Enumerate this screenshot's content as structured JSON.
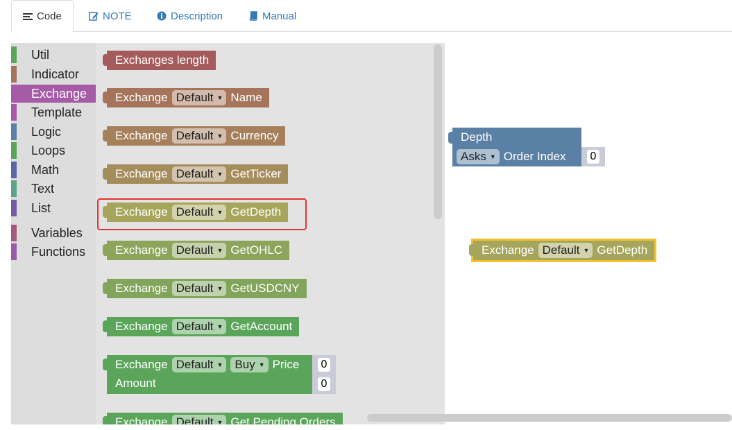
{
  "tabs": [
    {
      "label": "Code",
      "icon": "list-icon",
      "active": true
    },
    {
      "label": "NOTE",
      "icon": "edit-icon",
      "active": false
    },
    {
      "label": "Description",
      "icon": "info-icon",
      "active": false
    },
    {
      "label": "Manual",
      "icon": "book-icon",
      "active": false
    }
  ],
  "toolbox": {
    "categories": [
      {
        "label": "Util",
        "color": "#5ba55b"
      },
      {
        "label": "Indicator",
        "color": "#a5745b"
      },
      {
        "label": "Exchange",
        "color": "#a55ba5",
        "selected": true
      },
      {
        "label": "Template",
        "color": "#a55ba5"
      },
      {
        "label": "Logic",
        "color": "#5b80a5"
      },
      {
        "label": "Loops",
        "color": "#5ba55b"
      },
      {
        "label": "Math",
        "color": "#5b67a5"
      },
      {
        "label": "Text",
        "color": "#5ba58c"
      },
      {
        "label": "List",
        "color": "#745ba5"
      },
      {
        "label": "Variables",
        "color": "#a55b80"
      },
      {
        "label": "Functions",
        "color": "#995ba5"
      }
    ]
  },
  "flyout": {
    "blocks": [
      {
        "parts": [
          "Exchanges length"
        ],
        "color": "#a55b5b"
      },
      {
        "parts": [
          "Exchange",
          "Default",
          "Name"
        ],
        "color": "#a5745b"
      },
      {
        "parts": [
          "Exchange",
          "Default",
          "Currency"
        ],
        "color": "#a5805b"
      },
      {
        "parts": [
          "Exchange",
          "Default",
          "GetTicker"
        ],
        "color": "#a58c5b"
      },
      {
        "parts": [
          "Exchange",
          "Default",
          "GetDepth"
        ],
        "color": "#a5a55b",
        "highlighted": true
      },
      {
        "parts": [
          "Exchange",
          "Default",
          "GetOHLC"
        ],
        "color": "#8ca55b"
      },
      {
        "parts": [
          "Exchange",
          "Default",
          "GetUSDCNY"
        ],
        "color": "#80a55b"
      },
      {
        "parts": [
          "Exchange",
          "Default",
          "GetAccount"
        ],
        "color": "#5ba55b"
      },
      {
        "parts": [
          "Exchange",
          "Default",
          "Buy",
          "Price",
          "Amount"
        ],
        "values": [
          "0",
          "0"
        ],
        "color": "#5ba55b"
      },
      {
        "parts": [
          "Exchange",
          "Default",
          "Get Pending Orders"
        ],
        "color": "#5ba55b"
      }
    ]
  },
  "canvas": {
    "depth_block": {
      "title": "Depth",
      "field": "Asks",
      "label": "Order Index",
      "value": "0",
      "color": "#5b80a5"
    },
    "getdepth_block": {
      "parts": [
        "Exchange",
        "Default",
        "GetDepth"
      ],
      "color": "#a5a55b",
      "border": "#f6c131"
    }
  },
  "icons": {
    "dropdown": "triangle-down-icon"
  }
}
